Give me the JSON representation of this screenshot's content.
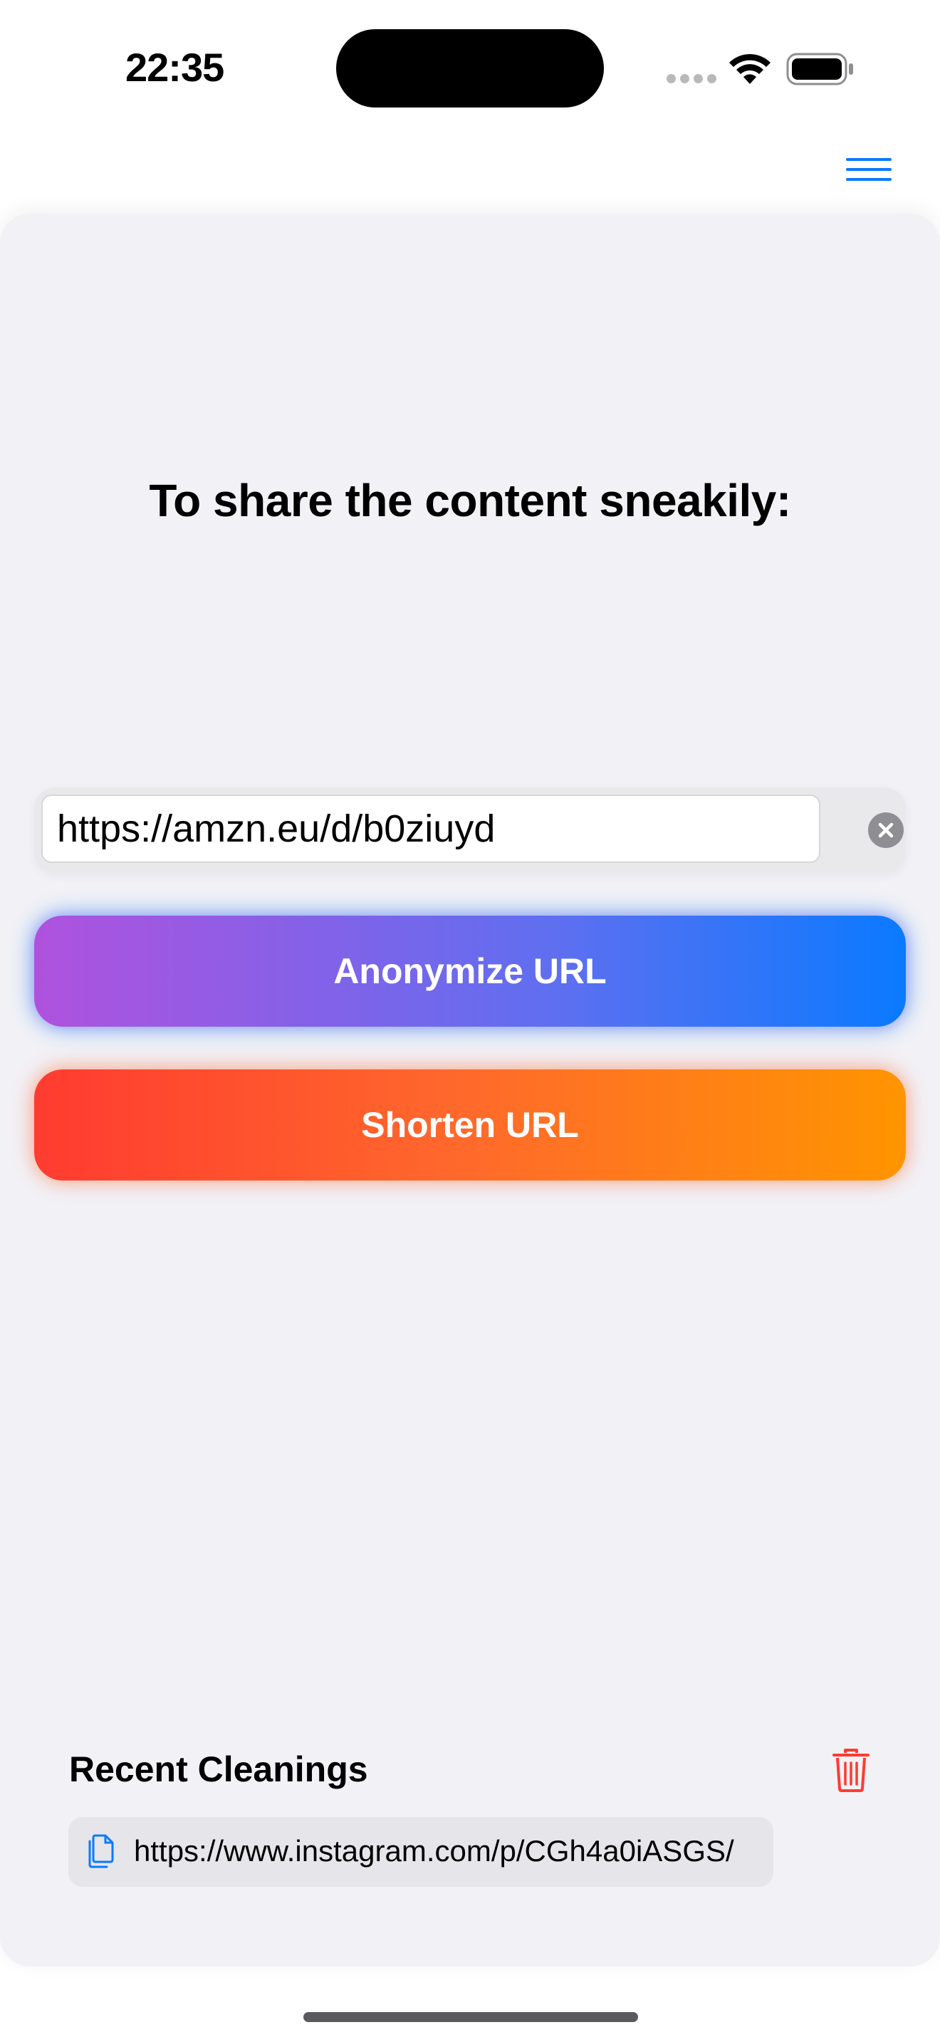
{
  "status_bar": {
    "time": "22:35",
    "wifi_icon": "wifi-icon",
    "battery_icon": "battery-icon",
    "signal_icon": "signal-dots-icon"
  },
  "nav": {
    "menu_icon": "hamburger-menu-icon",
    "accent_color": "#0a7aff"
  },
  "main": {
    "headline": "To share the content sneakily:",
    "url_input": {
      "value": "https://amzn.eu/d/b0ziuyd",
      "placeholder": ""
    },
    "clear_icon": "clear-x-icon",
    "anonymize_label": "Anonymize URL",
    "shorten_label": "Shorten URL"
  },
  "recent": {
    "title": "Recent Cleanings",
    "trash_icon": "trash-icon",
    "trash_color": "#ff3b30",
    "items": [
      {
        "icon": "document-copy-icon",
        "url": "https://www.instagram.com/p/CGh4a0iASGS/"
      }
    ]
  },
  "colors": {
    "background": "#ffffff",
    "card": "#f2f2f6",
    "anonymize_gradient": [
      "#af52de",
      "#0a7aff"
    ],
    "shorten_gradient": [
      "#ff3b30",
      "#ff9500"
    ]
  }
}
